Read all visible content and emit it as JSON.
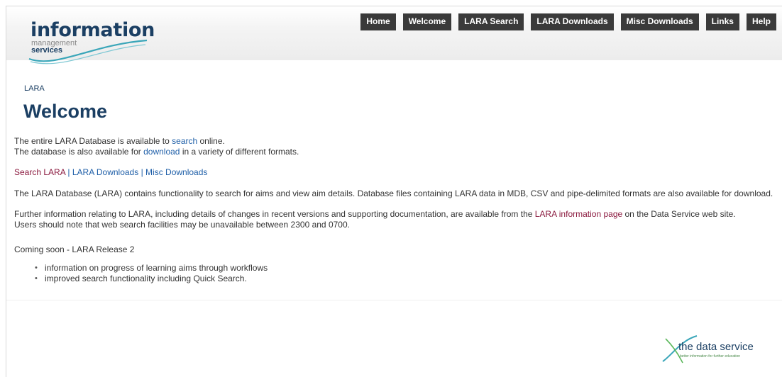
{
  "header": {
    "logo": {
      "line1": "information",
      "line2": "management",
      "line3": "services"
    },
    "nav": [
      {
        "label": "Home"
      },
      {
        "label": "Welcome"
      },
      {
        "label": "LARA Search"
      },
      {
        "label": "LARA Downloads"
      },
      {
        "label": "Misc Downloads"
      },
      {
        "label": "Links"
      },
      {
        "label": "Help"
      }
    ]
  },
  "main": {
    "breadcrumb": "LARA",
    "title": "Welcome",
    "intro": {
      "line1_pre": "The entire LARA Database is available to ",
      "line1_link": "search",
      "line1_post": " online.",
      "line2_pre": "The database is also available for ",
      "line2_link": "download",
      "line2_post": " in a variety of different formats."
    },
    "quick_links": {
      "search": "Search LARA",
      "sep": " | ",
      "downloads": "LARA Downloads",
      "misc": "Misc Downloads"
    },
    "description": "The LARA Database (LARA) contains functionality to search for aims and view aim details. Database files containing LARA data in MDB, CSV and pipe-delimited formats are also available for download.",
    "further": {
      "pre": "Further information relating to LARA, including details of changes in recent versions and supporting documentation, are available from the ",
      "link": "LARA information page",
      "post": " on the Data Service web site.",
      "line2": "Users should note that web search facilities may be unavailable between 2300 and 0700."
    },
    "coming_soon": "Coming soon - LARA Release 2",
    "bullets": [
      "information on progress of learning aims through workflows",
      "improved search functionality including Quick Search."
    ]
  },
  "footer": {
    "logo_text": "the data service",
    "logo_tagline": "better information for further education"
  },
  "colors": {
    "brand": "#1b3f63",
    "nav_bg": "#3a3a3a",
    "link": "#1f5fa8",
    "link_visited": "#8b1a3f"
  }
}
